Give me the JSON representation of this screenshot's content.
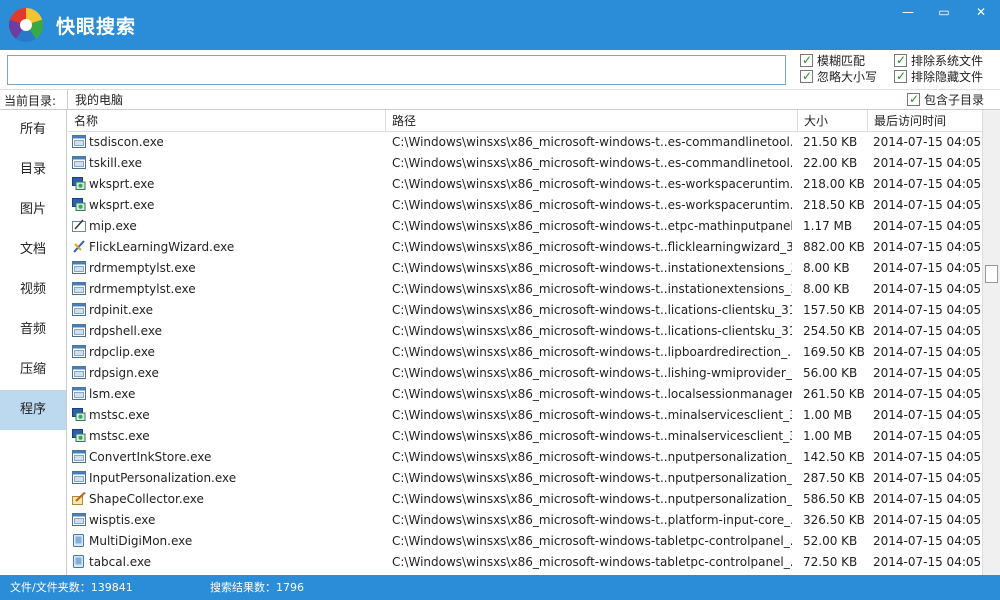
{
  "app": {
    "title": "快眼搜索"
  },
  "window": {
    "minimize": "—",
    "maximize": "▭",
    "close": "✕"
  },
  "search": {
    "value": "",
    "placeholder": ""
  },
  "options": {
    "fuzzy": "模糊匹配",
    "exclude_system": "排除系统文件",
    "ignore_case": "忽略大小写",
    "exclude_hidden": "排除隐藏文件",
    "include_subdirs": "包含子目录"
  },
  "current_dir": {
    "label": "当前目录:",
    "value": "我的电脑"
  },
  "sidebar": {
    "items": [
      {
        "label": "所有"
      },
      {
        "label": "目录"
      },
      {
        "label": "图片"
      },
      {
        "label": "文档"
      },
      {
        "label": "视频"
      },
      {
        "label": "音频"
      },
      {
        "label": "压缩"
      },
      {
        "label": "程序"
      }
    ],
    "active_index": 7
  },
  "table": {
    "headers": {
      "name": "名称",
      "path": "路径",
      "size": "大小",
      "time": "最后访问时间"
    },
    "rows": [
      {
        "icon": "app-window-icon",
        "name": "tsdiscon.exe",
        "path": "C:\\Windows\\winsxs\\x86_microsoft-windows-t..es-commandlinetool...",
        "size": "21.50 KB",
        "time": "2014-07-15 04:05"
      },
      {
        "icon": "app-window-icon",
        "name": "tskill.exe",
        "path": "C:\\Windows\\winsxs\\x86_microsoft-windows-t..es-commandlinetool...",
        "size": "22.00 KB",
        "time": "2014-07-15 04:05"
      },
      {
        "icon": "remote-app-icon",
        "name": "wksprt.exe",
        "path": "C:\\Windows\\winsxs\\x86_microsoft-windows-t..es-workspaceruntim...",
        "size": "218.00 KB",
        "time": "2014-07-15 04:05"
      },
      {
        "icon": "remote-app-icon",
        "name": "wksprt.exe",
        "path": "C:\\Windows\\winsxs\\x86_microsoft-windows-t..es-workspaceruntim...",
        "size": "218.50 KB",
        "time": "2014-07-15 04:05"
      },
      {
        "icon": "pen-tablet-icon",
        "name": "mip.exe",
        "path": "C:\\Windows\\winsxs\\x86_microsoft-windows-t..etpc-mathinputpanel...",
        "size": "1.17 MB",
        "time": "2014-07-15 04:05"
      },
      {
        "icon": "flick-pen-icon",
        "name": "FlickLearningWizard.exe",
        "path": "C:\\Windows\\winsxs\\x86_microsoft-windows-t..flicklearningwizard_3...",
        "size": "882.00 KB",
        "time": "2014-07-15 04:05"
      },
      {
        "icon": "app-window-icon",
        "name": "rdrmemptylst.exe",
        "path": "C:\\Windows\\winsxs\\x86_microsoft-windows-t..instationextensions_3...",
        "size": "8.00 KB",
        "time": "2014-07-15 04:05"
      },
      {
        "icon": "app-window-icon",
        "name": "rdrmemptylst.exe",
        "path": "C:\\Windows\\winsxs\\x86_microsoft-windows-t..instationextensions_3...",
        "size": "8.00 KB",
        "time": "2014-07-15 04:05"
      },
      {
        "icon": "app-window-icon",
        "name": "rdpinit.exe",
        "path": "C:\\Windows\\winsxs\\x86_microsoft-windows-t..lications-clientsku_31...",
        "size": "157.50 KB",
        "time": "2014-07-15 04:05"
      },
      {
        "icon": "app-window-icon",
        "name": "rdpshell.exe",
        "path": "C:\\Windows\\winsxs\\x86_microsoft-windows-t..lications-clientsku_31...",
        "size": "254.50 KB",
        "time": "2014-07-15 04:05"
      },
      {
        "icon": "app-window-icon",
        "name": "rdpclip.exe",
        "path": "C:\\Windows\\winsxs\\x86_microsoft-windows-t..lipboardredirection_...",
        "size": "169.50 KB",
        "time": "2014-07-15 04:05"
      },
      {
        "icon": "app-window-icon",
        "name": "rdpsign.exe",
        "path": "C:\\Windows\\winsxs\\x86_microsoft-windows-t..lishing-wmiprovider_...",
        "size": "56.00 KB",
        "time": "2014-07-15 04:05"
      },
      {
        "icon": "app-window-icon",
        "name": "lsm.exe",
        "path": "C:\\Windows\\winsxs\\x86_microsoft-windows-t..localsessionmanager...",
        "size": "261.50 KB",
        "time": "2014-07-15 04:05"
      },
      {
        "icon": "remote-app-icon",
        "name": "mstsc.exe",
        "path": "C:\\Windows\\winsxs\\x86_microsoft-windows-t..minalservicesclient_3...",
        "size": "1.00 MB",
        "time": "2014-07-15 04:05"
      },
      {
        "icon": "remote-app-icon",
        "name": "mstsc.exe",
        "path": "C:\\Windows\\winsxs\\x86_microsoft-windows-t..minalservicesclient_3...",
        "size": "1.00 MB",
        "time": "2014-07-15 04:05"
      },
      {
        "icon": "app-window-icon",
        "name": "ConvertInkStore.exe",
        "path": "C:\\Windows\\winsxs\\x86_microsoft-windows-t..nputpersonalization_...",
        "size": "142.50 KB",
        "time": "2014-07-15 04:05"
      },
      {
        "icon": "app-window-icon",
        "name": "InputPersonalization.exe",
        "path": "C:\\Windows\\winsxs\\x86_microsoft-windows-t..nputpersonalization_...",
        "size": "287.50 KB",
        "time": "2014-07-15 04:05"
      },
      {
        "icon": "pen-shape-icon",
        "name": "ShapeCollector.exe",
        "path": "C:\\Windows\\winsxs\\x86_microsoft-windows-t..nputpersonalization_...",
        "size": "586.50 KB",
        "time": "2014-07-15 04:05"
      },
      {
        "icon": "app-window-icon",
        "name": "wisptis.exe",
        "path": "C:\\Windows\\winsxs\\x86_microsoft-windows-t..platform-input-core_...",
        "size": "326.50 KB",
        "time": "2014-07-15 04:05"
      },
      {
        "icon": "tablet-pc-icon",
        "name": "MultiDigiMon.exe",
        "path": "C:\\Windows\\winsxs\\x86_microsoft-windows-tabletpc-controlpanel_...",
        "size": "52.00 KB",
        "time": "2014-07-15 04:05"
      },
      {
        "icon": "tablet-pc-icon",
        "name": "tabcal.exe",
        "path": "C:\\Windows\\winsxs\\x86_microsoft-windows-tabletpc-controlpanel_...",
        "size": "72.50 KB",
        "time": "2014-07-15 04:05"
      }
    ]
  },
  "status": {
    "files_count": "文件/文件夹数：139841",
    "results_count": "搜索结果数：1796"
  },
  "colors": {
    "accent": "#2b8dd8",
    "sidebar_active": "#bcd9ef"
  }
}
